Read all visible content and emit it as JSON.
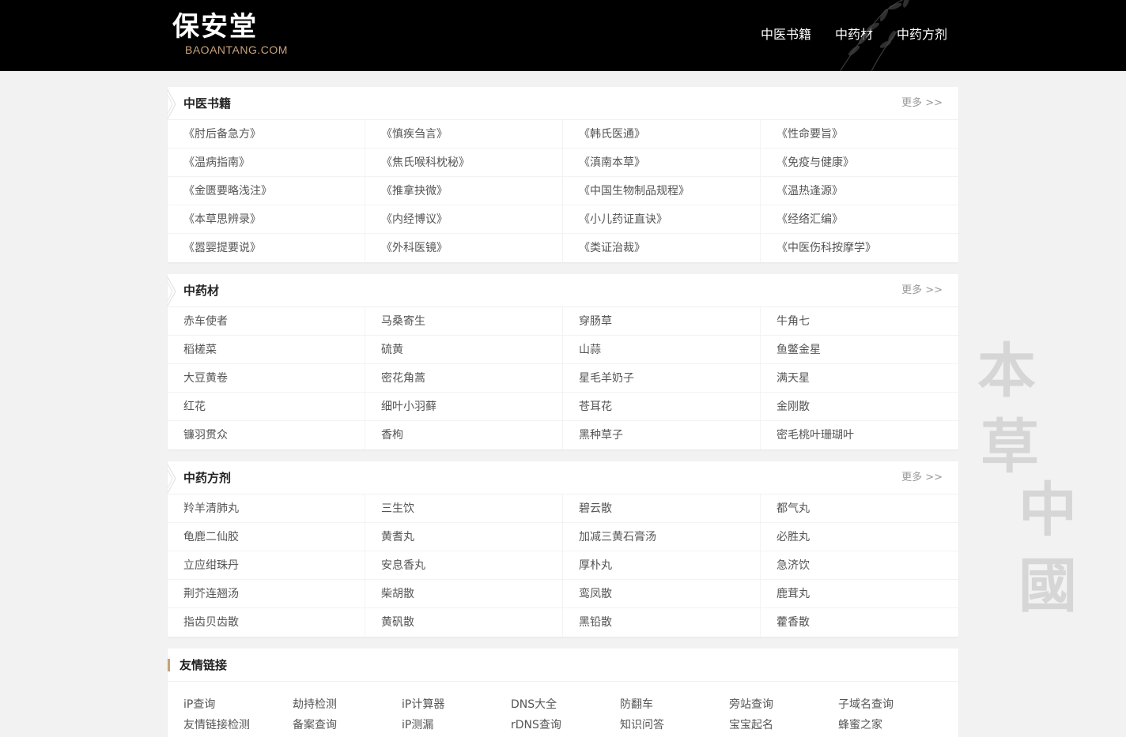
{
  "brand": {
    "name": "保安堂",
    "domain": "BAOANTANG.COM"
  },
  "nav": [
    {
      "label": "中医书籍"
    },
    {
      "label": "中药材"
    },
    {
      "label": "中药方剂"
    }
  ],
  "sections": [
    {
      "title": "中医书籍",
      "more": "更多 >>",
      "items": [
        "《肘后备急方》",
        "《慎疾刍言》",
        "《韩氏医通》",
        "《性命要旨》",
        "《温病指南》",
        "《焦氏喉科枕秘》",
        "《滇南本草》",
        "《免疫与健康》",
        "《金匮要略浅注》",
        "《推拿抉微》",
        "《中国生物制品规程》",
        "《温热逢源》",
        "《本草思辨录》",
        "《内经博议》",
        "《小儿药证直诀》",
        "《经络汇编》",
        "《嚣婴提要说》",
        "《外科医镜》",
        "《类证治裁》",
        "《中医伤科按摩学》"
      ]
    },
    {
      "title": "中药材",
      "more": "更多 >>",
      "items": [
        "赤车使者",
        "马桑寄生",
        "穿肠草",
        "牛角七",
        "稻槎菜",
        "硫黄",
        "山蒜",
        "鱼鳖金星",
        "大豆黄卷",
        "密花角蒿",
        "星毛羊奶子",
        "满天星",
        "红花",
        "细叶小羽藓",
        "苍耳花",
        "金刚散",
        "镰羽贯众",
        "香枸",
        "黑种草子",
        "密毛桃叶珊瑚叶"
      ]
    },
    {
      "title": "中药方剂",
      "more": "更多 >>",
      "items": [
        "羚羊清肺丸",
        "三生饮",
        "碧云散",
        "都气丸",
        "龟鹿二仙胶",
        "黄耆丸",
        "加减三黄石膏汤",
        "必胜丸",
        "立应绀珠丹",
        "安息香丸",
        "厚朴丸",
        "急济饮",
        "荆芥连翘汤",
        "柴胡散",
        "鸾凤散",
        "鹿茸丸",
        "指齿贝齿散",
        "黄矾散",
        "黑铅散",
        "藿香散"
      ]
    }
  ],
  "friend_links": {
    "title": "友情链接",
    "items": [
      "iP查询",
      "劫持检测",
      "iP计算器",
      "DNS大全",
      "防翻车",
      "旁站查询",
      "子域名查询",
      "友情链接检测",
      "备案查询",
      "iP测漏",
      "rDNS查询",
      "知识问答",
      "宝宝起名",
      "蜂蜜之家"
    ]
  },
  "watermark": [
    "本",
    "草",
    "中",
    "國"
  ],
  "colors": {
    "header_bg": "#000000",
    "accent": "#c8a27a",
    "page_bg": "#f2f2f2"
  }
}
